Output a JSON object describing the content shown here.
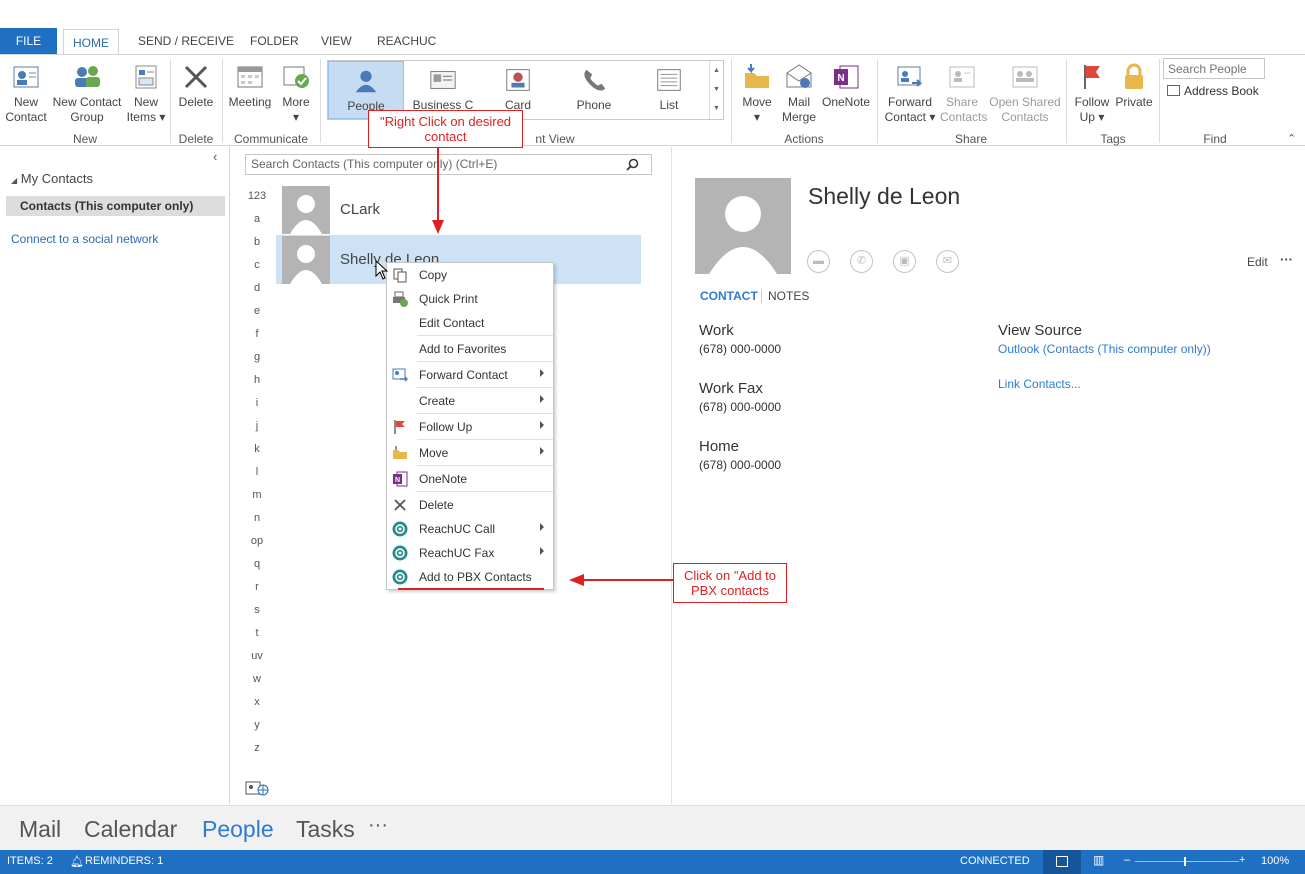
{
  "tabs": [
    "FILE",
    "HOME",
    "SEND / RECEIVE",
    "FOLDER",
    "VIEW",
    "REACHUC"
  ],
  "ribbon": {
    "new_contact": "New\nContact",
    "new_contact_group": "New Contact\nGroup",
    "new_items": "New\nItems ▾",
    "delete": "Delete",
    "meeting": "Meeting",
    "more": "More\n▾",
    "views": [
      "People",
      "Business C",
      "Card",
      "Phone",
      "List"
    ],
    "move": "Move\n▾",
    "mail_merge": "Mail\nMerge",
    "onenote": "OneNote",
    "forward_contact": "Forward\nContact ▾",
    "share_contacts": "Share\nContacts",
    "open_shared_contacts": "Open Shared\nContacts",
    "follow_up": "Follow\nUp ▾",
    "private": "Private",
    "search_people_placeholder": "Search People",
    "address_book": "Address Book",
    "groups": {
      "new": "New",
      "delete": "Delete",
      "communicate": "Communicate",
      "current_view_partial": "nt View",
      "actions": "Actions",
      "share": "Share",
      "tags": "Tags",
      "find": "Find"
    }
  },
  "leftnav": {
    "my_contacts": "My Contacts",
    "folder": "Contacts (This computer only)",
    "social": "Connect to a social network"
  },
  "list": {
    "search_placeholder": "Search Contacts (This computer only) (Ctrl+E)",
    "alphabet": [
      "123",
      "a",
      "b",
      "c",
      "d",
      "e",
      "f",
      "g",
      "h",
      "i",
      "j",
      "k",
      "l",
      "m",
      "n",
      "op",
      "q",
      "r",
      "s",
      "t",
      "uv",
      "w",
      "x",
      "y",
      "z"
    ],
    "contacts": [
      "CLark",
      "Shelly de Leon"
    ]
  },
  "context_menu": [
    {
      "label": "Copy",
      "icon": "copy-icon",
      "arrow": false
    },
    {
      "label": "Quick Print",
      "icon": "quick-print-icon",
      "arrow": false
    },
    {
      "label": "Edit Contact",
      "icon": "",
      "arrow": false
    },
    {
      "label": "Add to Favorites",
      "icon": "",
      "arrow": false
    },
    {
      "label": "Forward Contact",
      "icon": "forward-contact-icon",
      "arrow": true
    },
    {
      "label": "Create",
      "icon": "",
      "arrow": true
    },
    {
      "label": "Follow Up",
      "icon": "flag-icon",
      "arrow": true
    },
    {
      "label": "Move",
      "icon": "folder-icon",
      "arrow": true
    },
    {
      "label": "OneNote",
      "icon": "onenote-icon",
      "arrow": false
    },
    {
      "label": "Delete",
      "icon": "delete-icon",
      "arrow": false
    },
    {
      "label": "ReachUC Call",
      "icon": "reachuc-icon",
      "arrow": true
    },
    {
      "label": "ReachUC Fax",
      "icon": "reachuc-icon",
      "arrow": true
    },
    {
      "label": "Add to PBX Contacts",
      "icon": "reachuc-icon",
      "arrow": false
    }
  ],
  "reading": {
    "name": "Shelly de Leon",
    "edit": "Edit",
    "more": "···",
    "tab_contact": "CONTACT",
    "tab_notes": "NOTES",
    "work_label": "Work",
    "work_value": "(678) 000-0000",
    "workfax_label": "Work Fax",
    "workfax_value": "(678) 000-0000",
    "home_label": "Home",
    "home_value": "(678) 000-0000",
    "view_source": "View Source",
    "source_link": "Outlook (Contacts (This computer only))",
    "link_contacts": "Link Contacts..."
  },
  "annotations": {
    "right_click": "\"Right Click on desired contact",
    "click_add": "Click on \"Add to PBX contacts"
  },
  "bottomnav": [
    "Mail",
    "Calendar",
    "People",
    "Tasks",
    "···"
  ],
  "status": {
    "items": "ITEMS: 2",
    "reminders": "REMINDERS: 1",
    "connected": "CONNECTED",
    "zoom": "100%"
  },
  "colors": {
    "accent": "#1f6fc2",
    "selected_row": "#cde3f5",
    "annotation": "#e02020"
  }
}
